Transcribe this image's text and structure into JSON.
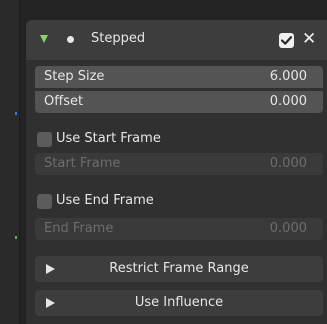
{
  "modifier": {
    "title": "Stepped",
    "enabled": true,
    "accent_color": "#8ad16b",
    "icons": {
      "expand": "triangle-down-icon",
      "type": "dot-icon",
      "toggle": "checkbox-checked-icon",
      "remove": "close-icon"
    }
  },
  "labels": {
    "close": "✕"
  },
  "fields": {
    "step_size": {
      "label": "Step Size",
      "value": "6.000"
    },
    "offset": {
      "label": "Offset",
      "value": "0.000"
    },
    "start_frame": {
      "label": "Start Frame",
      "value": "0.000"
    },
    "end_frame": {
      "label": "End Frame",
      "value": "0.000"
    }
  },
  "checkboxes": {
    "use_start_frame": {
      "label": "Use Start Frame",
      "checked": false
    },
    "use_end_frame": {
      "label": "Use End Frame",
      "checked": false
    }
  },
  "subpanels": [
    {
      "label": "Restrict Frame Range",
      "expanded": false
    },
    {
      "label": "Use Influence",
      "expanded": false
    }
  ]
}
